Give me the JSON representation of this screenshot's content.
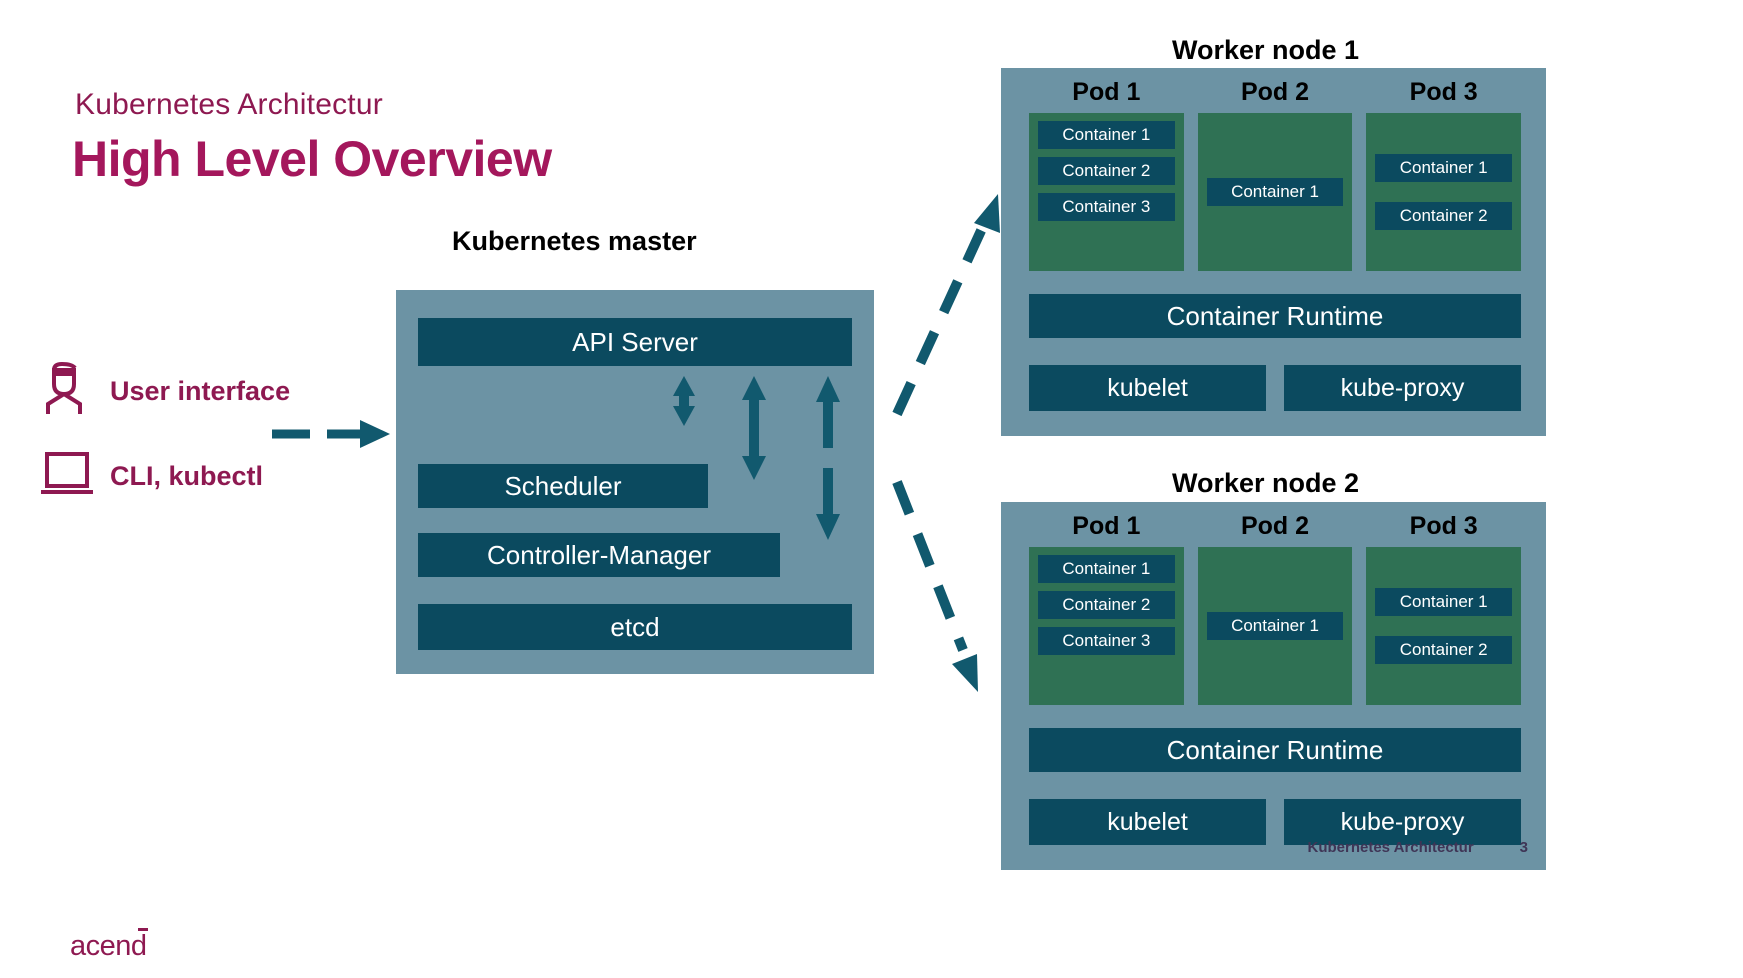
{
  "slide": {
    "kicker": "Kubernetes Architectur",
    "title": "High Level Overview",
    "brand": "acend",
    "footer_title": "Kubernetes Architectur",
    "page_number": "3"
  },
  "colors": {
    "brand_magenta": "#a4175c",
    "brand_plum": "#8e1951",
    "panel_blue_gray": "#6c93a4",
    "component_teal": "#0b4a5f",
    "pod_green": "#2f7154",
    "text_white": "#ffffff",
    "text_black": "#000000",
    "footer_text": "#3f3556"
  },
  "actors": [
    {
      "label": "User interface",
      "icon": "user-icon"
    },
    {
      "label": "CLI, kubectl",
      "icon": "laptop-icon"
    }
  ],
  "master": {
    "title": "Kubernetes master",
    "components": [
      {
        "id": "api-server",
        "label": "API Server"
      },
      {
        "id": "scheduler",
        "label": "Scheduler"
      },
      {
        "id": "controller-manager",
        "label": "Controller-Manager"
      },
      {
        "id": "etcd",
        "label": "etcd"
      }
    ]
  },
  "workers": [
    {
      "title": "Worker node 1",
      "pods": [
        {
          "label": "Pod 1",
          "containers": [
            "Container 1",
            "Container 2",
            "Container 3"
          ]
        },
        {
          "label": "Pod 2",
          "containers": [
            "Container 1"
          ]
        },
        {
          "label": "Pod 3",
          "containers": [
            "Container 1",
            "Container 2"
          ]
        }
      ],
      "runtime": "Container Runtime",
      "daemons": [
        "kubelet",
        "kube-proxy"
      ]
    },
    {
      "title": "Worker node 2",
      "pods": [
        {
          "label": "Pod 1",
          "containers": [
            "Container 1",
            "Container 2",
            "Container 3"
          ]
        },
        {
          "label": "Pod 2",
          "containers": [
            "Container 1"
          ]
        },
        {
          "label": "Pod 3",
          "containers": [
            "Container 1",
            "Container 2"
          ]
        }
      ],
      "runtime": "Container Runtime",
      "daemons": [
        "kubelet",
        "kube-proxy"
      ]
    }
  ]
}
